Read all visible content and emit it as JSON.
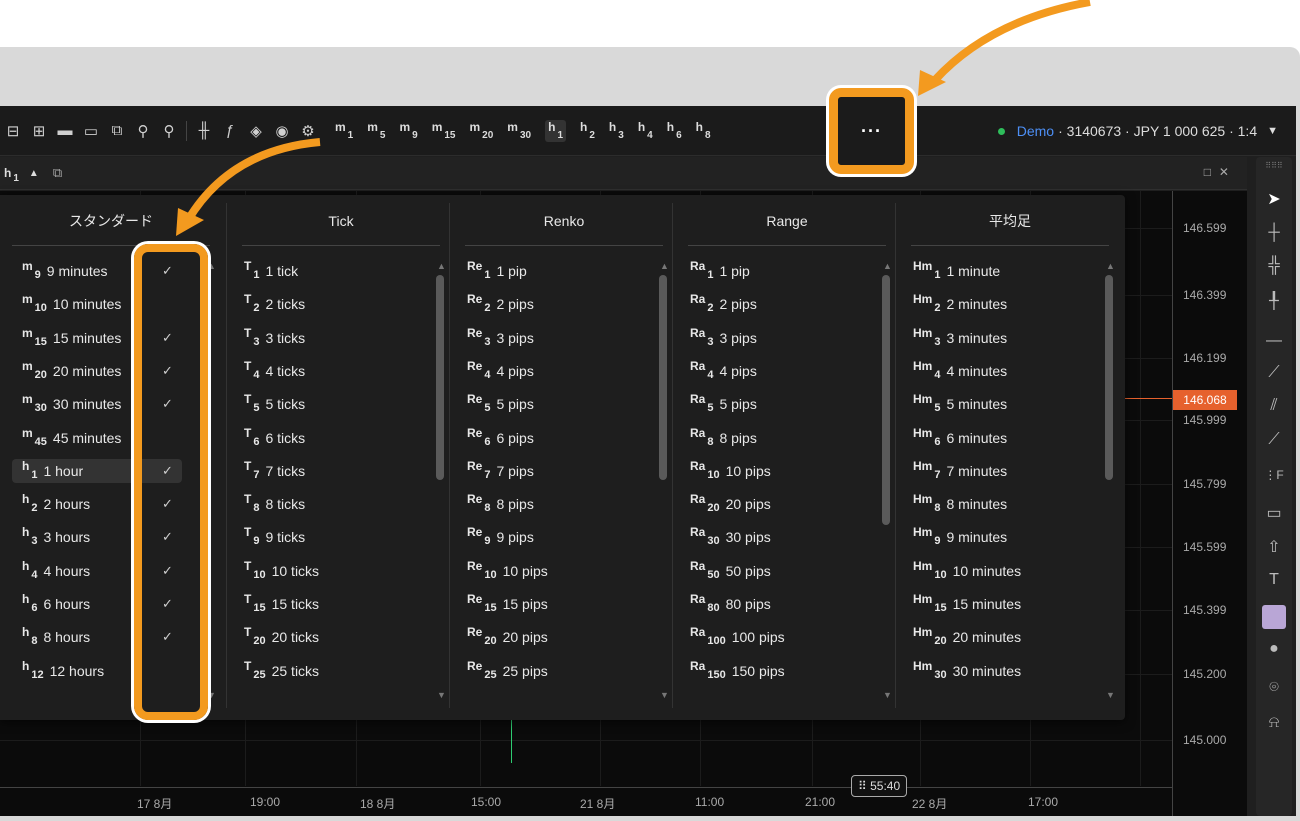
{
  "toolbar": {
    "timeframes": [
      {
        "code": "m",
        "num": "1"
      },
      {
        "code": "m",
        "num": "5"
      },
      {
        "code": "m",
        "num": "9"
      },
      {
        "code": "m",
        "num": "15"
      },
      {
        "code": "m",
        "num": "20"
      },
      {
        "code": "m",
        "num": "30"
      },
      {
        "code": "h",
        "num": "1",
        "active": true
      },
      {
        "code": "h",
        "num": "2"
      },
      {
        "code": "h",
        "num": "3"
      },
      {
        "code": "h",
        "num": "4"
      },
      {
        "code": "h",
        "num": "6"
      },
      {
        "code": "h",
        "num": "8"
      }
    ],
    "more_label": "···",
    "account": {
      "mode": "Demo",
      "details": "· 3140673 · JPY 1 000 625 · 1:4",
      "status_color": "#2ebd5b"
    }
  },
  "subbar": {
    "timeframe_code": "h",
    "timeframe_num": "1",
    "caret": "▲"
  },
  "price_axis": [
    "146.599",
    "146.399",
    "146.199",
    "145.999",
    "145.799",
    "145.599",
    "145.399",
    "145.200",
    "145.000"
  ],
  "current_price": "146.068",
  "time_axis": [
    "17 8月",
    "19:00",
    "18 8月",
    "15:00",
    "21 8月",
    "11:00",
    "21:00",
    "22 8月",
    "17:00"
  ],
  "cursor_time": "55:40",
  "panel": {
    "columns": [
      {
        "title": "スタンダード",
        "items": [
          {
            "code": "m",
            "num": "9",
            "label": "9 minutes",
            "checked": true
          },
          {
            "code": "m",
            "num": "10",
            "label": "10 minutes",
            "checked": false
          },
          {
            "code": "m",
            "num": "15",
            "label": "15 minutes",
            "checked": true
          },
          {
            "code": "m",
            "num": "20",
            "label": "20 minutes",
            "checked": true
          },
          {
            "code": "m",
            "num": "30",
            "label": "30 minutes",
            "checked": true
          },
          {
            "code": "m",
            "num": "45",
            "label": "45 minutes",
            "checked": false
          },
          {
            "code": "h",
            "num": "1",
            "label": "1 hour",
            "checked": true,
            "selected": true
          },
          {
            "code": "h",
            "num": "2",
            "label": "2 hours",
            "checked": true
          },
          {
            "code": "h",
            "num": "3",
            "label": "3 hours",
            "checked": true
          },
          {
            "code": "h",
            "num": "4",
            "label": "4 hours",
            "checked": true
          },
          {
            "code": "h",
            "num": "6",
            "label": "6 hours",
            "checked": true
          },
          {
            "code": "h",
            "num": "8",
            "label": "8 hours",
            "checked": true
          },
          {
            "code": "h",
            "num": "12",
            "label": "12 hours",
            "checked": false
          }
        ]
      },
      {
        "title": "Tick",
        "items": [
          {
            "code": "T",
            "num": "1",
            "label": "1 tick"
          },
          {
            "code": "T",
            "num": "2",
            "label": "2 ticks"
          },
          {
            "code": "T",
            "num": "3",
            "label": "3 ticks"
          },
          {
            "code": "T",
            "num": "4",
            "label": "4 ticks"
          },
          {
            "code": "T",
            "num": "5",
            "label": "5 ticks"
          },
          {
            "code": "T",
            "num": "6",
            "label": "6 ticks"
          },
          {
            "code": "T",
            "num": "7",
            "label": "7 ticks"
          },
          {
            "code": "T",
            "num": "8",
            "label": "8 ticks"
          },
          {
            "code": "T",
            "num": "9",
            "label": "9 ticks"
          },
          {
            "code": "T",
            "num": "10",
            "label": "10 ticks"
          },
          {
            "code": "T",
            "num": "15",
            "label": "15 ticks"
          },
          {
            "code": "T",
            "num": "20",
            "label": "20 ticks"
          },
          {
            "code": "T",
            "num": "25",
            "label": "25 ticks"
          }
        ]
      },
      {
        "title": "Renko",
        "items": [
          {
            "code": "Re",
            "num": "1",
            "label": "1 pip"
          },
          {
            "code": "Re",
            "num": "2",
            "label": "2 pips"
          },
          {
            "code": "Re",
            "num": "3",
            "label": "3 pips"
          },
          {
            "code": "Re",
            "num": "4",
            "label": "4 pips"
          },
          {
            "code": "Re",
            "num": "5",
            "label": "5 pips"
          },
          {
            "code": "Re",
            "num": "6",
            "label": "6 pips"
          },
          {
            "code": "Re",
            "num": "7",
            "label": "7 pips"
          },
          {
            "code": "Re",
            "num": "8",
            "label": "8 pips"
          },
          {
            "code": "Re",
            "num": "9",
            "label": "9 pips"
          },
          {
            "code": "Re",
            "num": "10",
            "label": "10 pips"
          },
          {
            "code": "Re",
            "num": "15",
            "label": "15 pips"
          },
          {
            "code": "Re",
            "num": "20",
            "label": "20 pips"
          },
          {
            "code": "Re",
            "num": "25",
            "label": "25 pips"
          }
        ]
      },
      {
        "title": "Range",
        "items": [
          {
            "code": "Ra",
            "num": "1",
            "label": "1 pip"
          },
          {
            "code": "Ra",
            "num": "2",
            "label": "2 pips"
          },
          {
            "code": "Ra",
            "num": "3",
            "label": "3 pips"
          },
          {
            "code": "Ra",
            "num": "4",
            "label": "4 pips"
          },
          {
            "code": "Ra",
            "num": "5",
            "label": "5 pips"
          },
          {
            "code": "Ra",
            "num": "8",
            "label": "8 pips"
          },
          {
            "code": "Ra",
            "num": "10",
            "label": "10 pips"
          },
          {
            "code": "Ra",
            "num": "20",
            "label": "20 pips"
          },
          {
            "code": "Ra",
            "num": "30",
            "label": "30 pips"
          },
          {
            "code": "Ra",
            "num": "50",
            "label": "50 pips"
          },
          {
            "code": "Ra",
            "num": "80",
            "label": "80 pips"
          },
          {
            "code": "Ra",
            "num": "100",
            "label": "100 pips"
          },
          {
            "code": "Ra",
            "num": "150",
            "label": "150 pips"
          }
        ]
      },
      {
        "title": "平均足",
        "items": [
          {
            "code": "Hm",
            "num": "1",
            "label": "1 minute"
          },
          {
            "code": "Hm",
            "num": "2",
            "label": "2 minutes"
          },
          {
            "code": "Hm",
            "num": "3",
            "label": "3 minutes"
          },
          {
            "code": "Hm",
            "num": "4",
            "label": "4 minutes"
          },
          {
            "code": "Hm",
            "num": "5",
            "label": "5 minutes"
          },
          {
            "code": "Hm",
            "num": "6",
            "label": "6 minutes"
          },
          {
            "code": "Hm",
            "num": "7",
            "label": "7 minutes"
          },
          {
            "code": "Hm",
            "num": "8",
            "label": "8 minutes"
          },
          {
            "code": "Hm",
            "num": "9",
            "label": "9 minutes"
          },
          {
            "code": "Hm",
            "num": "10",
            "label": "10 minutes"
          },
          {
            "code": "Hm",
            "num": "15",
            "label": "15 minutes"
          },
          {
            "code": "Hm",
            "num": "20",
            "label": "20 minutes"
          },
          {
            "code": "Hm",
            "num": "30",
            "label": "30 minutes"
          }
        ]
      }
    ]
  },
  "colors": {
    "highlight": "#f39a1f",
    "price_tag": "#e6612d",
    "demo": "#4d8ff5"
  }
}
